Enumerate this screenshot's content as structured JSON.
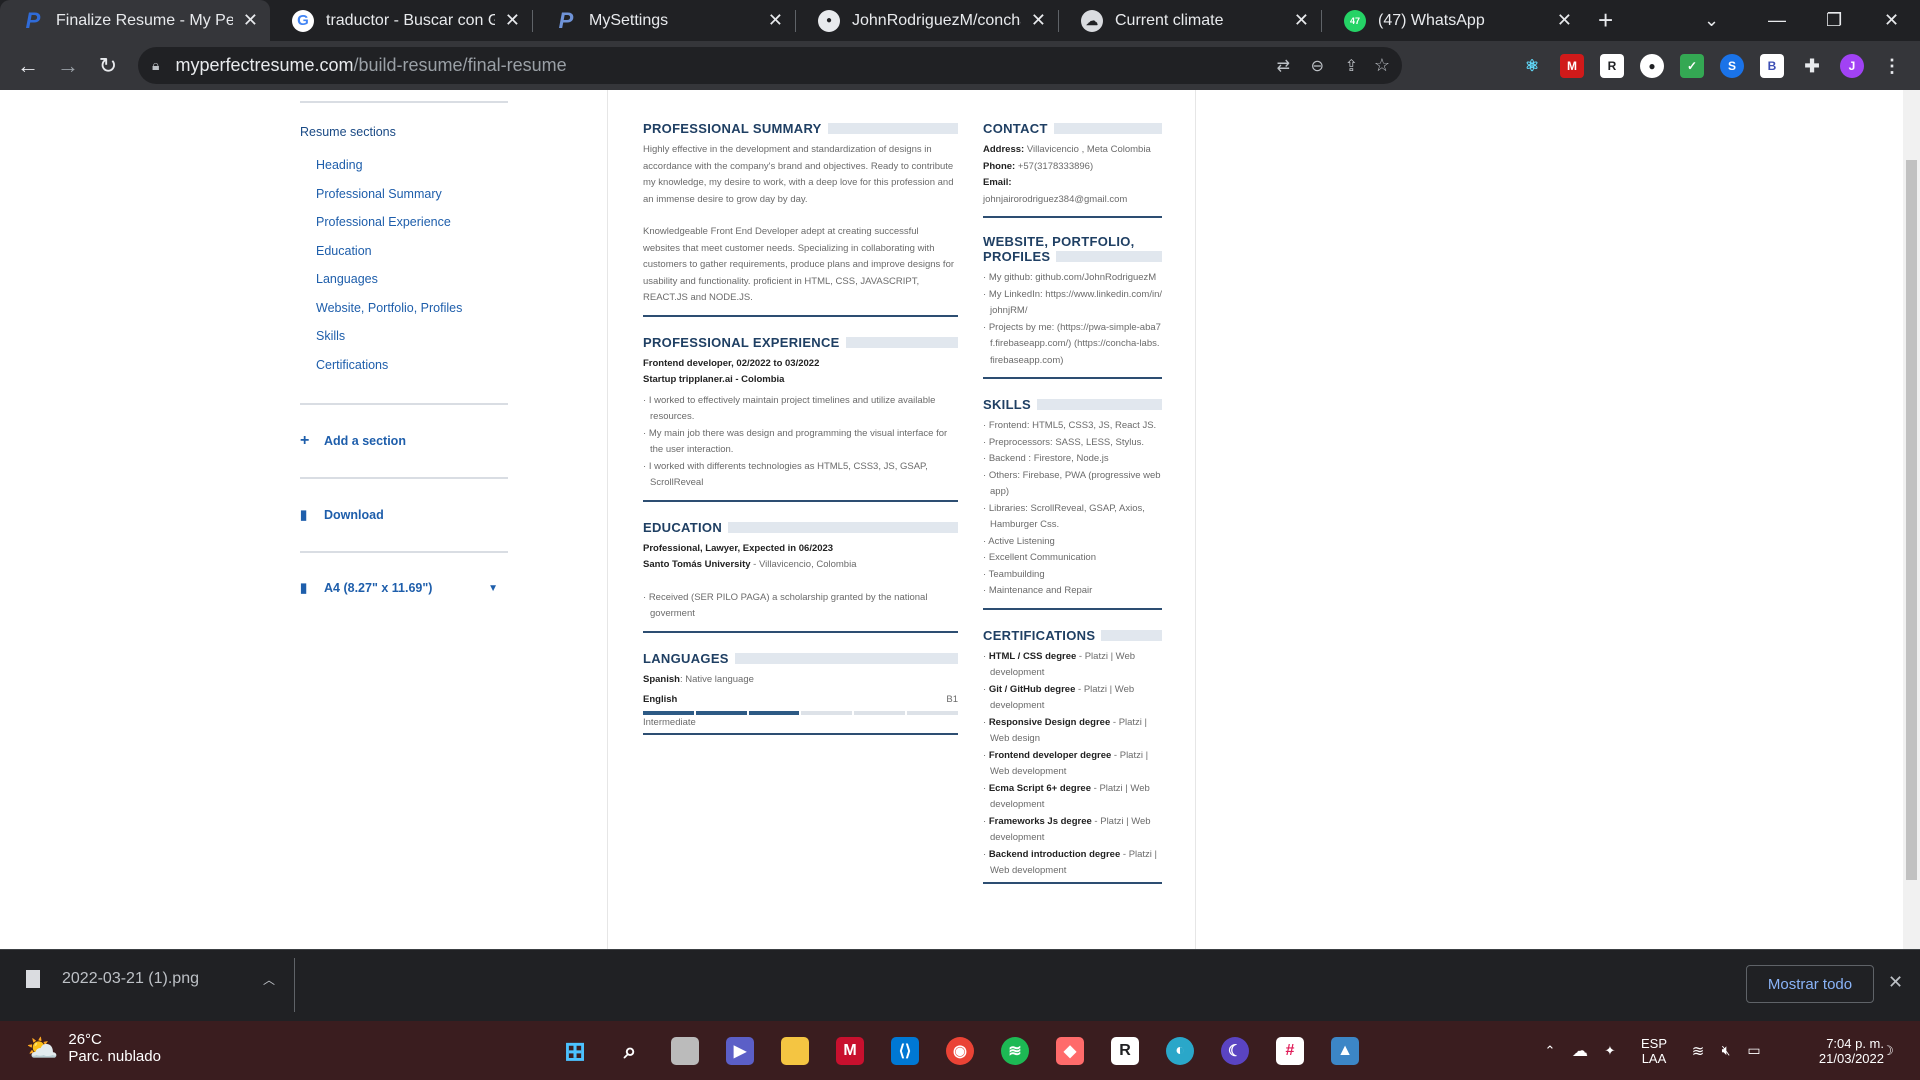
{
  "browser": {
    "tabs": [
      {
        "title": "Finalize Resume - My Perfec",
        "favicon": "P",
        "active": true
      },
      {
        "title": "traductor - Buscar con Goo",
        "favicon": "G",
        "active": false
      },
      {
        "title": "MySettings",
        "favicon": "P",
        "active": false
      },
      {
        "title": "JohnRodriguezM/concha-la",
        "favicon": "GH",
        "active": false
      },
      {
        "title": "Current climate",
        "favicon": "C",
        "active": false
      },
      {
        "title": "(47) WhatsApp",
        "favicon": "47",
        "active": false
      }
    ],
    "url_host": "myperfectresume.com",
    "url_path": "/build-resume/final-resume",
    "profile_initial": "J"
  },
  "sidebar": {
    "title": "Resume sections",
    "items": [
      "Heading",
      "Professional Summary",
      "Professional Experience",
      "Education",
      "Languages",
      "Website, Portfolio, Profiles",
      "Skills",
      "Certifications"
    ],
    "add_section": "Add a section",
    "download": "Download",
    "paper_size": "A4 (8.27\" x 11.69\")"
  },
  "resume": {
    "summary": {
      "heading": "PROFESSIONAL SUMMARY",
      "p1": "Highly effective in the development and standardization of designs in accordance with the company's brand and objectives. Ready to contribute my knowledge, my desire to work, with a deep love for this profession and an immense desire to grow day by day.",
      "p2": "Knowledgeable Front End Developer adept at creating successful websites that meet customer needs. Specializing in collaborating with customers to gather requirements, produce plans and improve designs for usability and functionality. proficient in HTML, CSS, JAVASCRIPT, REACT.JS and NODE.JS."
    },
    "experience": {
      "heading": "PROFESSIONAL EXPERIENCE",
      "role": "Frontend developer, 02/2022 to 03/2022",
      "company": "Startup tripplaner.ai - Colombia",
      "bullets": [
        "I worked to effectively maintain project timelines and utilize available resources.",
        "My main job there was design and programming the visual interface for the user interaction.",
        "I worked with differents technologies as HTML5, CSS3, JS, GSAP, ScrollReveal"
      ]
    },
    "education": {
      "heading": "EDUCATION",
      "degree": "Professional, Lawyer, Expected in 06/2023",
      "school": "Santo Tomás University",
      "location": " - Villavicencio, Colombia",
      "bullet": "Received (SER PILO PAGA) a scholarship granted by the national goverment"
    },
    "languages": {
      "heading": "LANGUAGES",
      "spanish_label": "Spanish",
      "spanish_level": ": Native language",
      "english_label": "English",
      "english_code": "B1",
      "english_level": "Intermediate",
      "english_fraction": 0.5
    },
    "contact": {
      "heading": "CONTACT",
      "address_label": "Address:",
      "address": " Villavicencio , Meta Colombia",
      "phone_label": "Phone:",
      "phone": " +57(3178333896)",
      "email_label": "Email:",
      "email": "johnjairorodriguez384@gmail.com"
    },
    "website": {
      "heading_line1": "WEBSITE, PORTFOLIO,",
      "heading_line2": "PROFILES",
      "items": [
        "My github: github.com/JohnRodriguezM",
        "My LinkedIn: https://www.linkedin.com/in/johnjRM/",
        "Projects by me: (https://pwa-simple-aba7f.firebaseapp.com/) (https://concha-labs.firebaseapp.com)"
      ]
    },
    "skills": {
      "heading": "SKILLS",
      "items": [
        "Frontend: HTML5, CSS3, JS, React JS.",
        "Preprocessors: SASS, LESS, Stylus.",
        "Backend : Firestore, Node.js",
        "Others: Firebase, PWA (progressive web app)",
        "Libraries: ScrollReveal, GSAP, Axios, Hamburger Css.",
        "Active Listening",
        "Excellent Communication",
        "Teambuilding",
        "Maintenance and Repair"
      ]
    },
    "certifications": {
      "heading": "CERTIFICATIONS",
      "items": [
        {
          "name": "HTML / CSS degree",
          "detail": " - Platzi | Web development"
        },
        {
          "name": "Git / GitHub degree",
          "detail": " - Platzi | Web development"
        },
        {
          "name": "Responsive Design degree",
          "detail": " - Platzi | Web design"
        },
        {
          "name": "Frontend developer degree",
          "detail": " - Platzi | Web development"
        },
        {
          "name": "Ecma Script 6+ degree",
          "detail": " - Platzi | Web development"
        },
        {
          "name": "Frameworks Js degree",
          "detail": " - Platzi | Web development"
        },
        {
          "name": "Backend introduction degree",
          "detail": " - Platzi | Web development"
        }
      ]
    }
  },
  "downloads": {
    "file": "2022-03-21 (1).png",
    "show_all": "Mostrar todo"
  },
  "taskbar": {
    "temperature": "26°C",
    "weather": "Parc. nublado",
    "lang1": "ESP",
    "lang2": "LAA",
    "time": "7:04 p. m.",
    "date": "21/03/2022"
  }
}
